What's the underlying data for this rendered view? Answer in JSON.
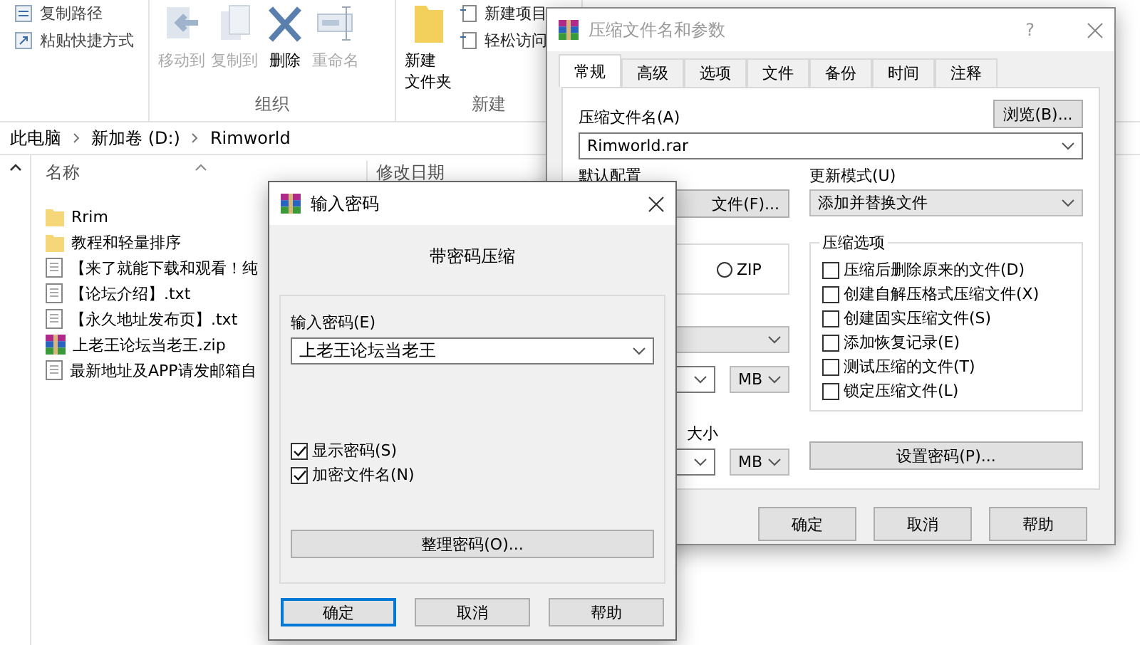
{
  "explorer": {
    "ribbon": {
      "clipboard_items": [
        "复制路径",
        "粘贴快捷方式"
      ],
      "organize": {
        "label": "组织",
        "items": [
          {
            "kind": "move",
            "label": "移动到",
            "disabled": true
          },
          {
            "kind": "copy",
            "label": "复制到",
            "disabled": true
          },
          {
            "kind": "delete",
            "label": "删除",
            "disabled": false
          },
          {
            "kind": "rename",
            "label": "重命名",
            "disabled": true
          }
        ]
      },
      "new": {
        "label": "新建",
        "folder_button": [
          "新建",
          "文件夹"
        ],
        "small_items": [
          "新建项目",
          "轻松访问"
        ]
      }
    },
    "address": [
      "此电脑",
      "新加卷 (D:)",
      "Rimworld"
    ],
    "columns": [
      "名称",
      "修改日期"
    ],
    "files": [
      {
        "kind": "folder",
        "name": "Rrim"
      },
      {
        "kind": "folder",
        "name": "教程和轻量排序"
      },
      {
        "kind": "text",
        "name": "【来了就能下载和观看！纯"
      },
      {
        "kind": "text",
        "name": "【论坛介绍】.txt"
      },
      {
        "kind": "text",
        "name": "【永久地址发布页】.txt"
      },
      {
        "kind": "archive",
        "name": "上老王论坛当老王.zip"
      },
      {
        "kind": "text",
        "name": "最新地址及APP请发邮箱自"
      }
    ]
  },
  "archive_dialog": {
    "title": "压缩文件名和参数",
    "help": "?",
    "tabs": [
      {
        "label": "常规",
        "selected": true
      },
      {
        "label": "高级",
        "selected": false
      },
      {
        "label": "选项",
        "selected": false
      },
      {
        "label": "文件",
        "selected": false
      },
      {
        "label": "备份",
        "selected": false
      },
      {
        "label": "时间",
        "selected": false
      },
      {
        "label": "注释",
        "selected": false
      }
    ],
    "archive_name_label": "压缩文件名(A)",
    "browse_button": "浏览(B)...",
    "archive_name": "Rimworld.rar",
    "profile_label": "默认配置",
    "profile_button": "文件(F)...",
    "format_option": {
      "label": "ZIP",
      "selected": false
    },
    "update_mode_label": "更新模式(U)",
    "update_mode": "添加并替换文件",
    "options_title": "压缩选项",
    "options": [
      {
        "label": "压缩后删除原来的文件(D)",
        "checked": false
      },
      {
        "label": "创建自解压格式压缩文件(X)",
        "checked": false
      },
      {
        "label": "创建固实压缩文件(S)",
        "checked": false
      },
      {
        "label": "添加恢复记录(E)",
        "checked": false
      },
      {
        "label": "测试压缩的文件(T)",
        "checked": false
      },
      {
        "label": "锁定压缩文件(L)",
        "checked": false
      }
    ],
    "size_label": "大小",
    "units": [
      "MB",
      "MB"
    ],
    "set_password_button": "设置密码(P)...",
    "buttons": [
      "确定",
      "取消",
      "帮助"
    ]
  },
  "password_dialog": {
    "title": "输入密码",
    "heading": "带密码压缩",
    "password_label": "输入密码(E)",
    "password": "上老王论坛当老王",
    "options": [
      {
        "label": "显示密码(S)",
        "checked": true
      },
      {
        "label": "加密文件名(N)",
        "checked": true
      }
    ],
    "organize_button": "整理密码(O)...",
    "buttons": [
      {
        "label": "确定",
        "default": true
      },
      {
        "label": "取消",
        "default": false
      },
      {
        "label": "帮助",
        "default": false
      }
    ]
  }
}
